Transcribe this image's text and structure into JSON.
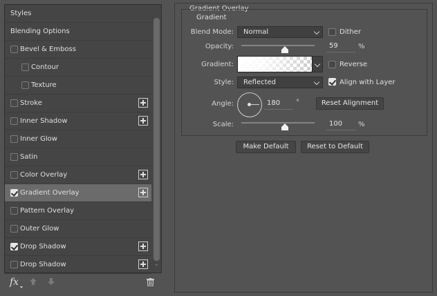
{
  "styles_list": {
    "header": "Styles",
    "blending_options": "Blending Options",
    "items": [
      {
        "label": "Bevel & Emboss",
        "checked": false,
        "add": false,
        "indent": false,
        "selected": false
      },
      {
        "label": "Contour",
        "checked": false,
        "add": false,
        "indent": true,
        "selected": false
      },
      {
        "label": "Texture",
        "checked": false,
        "add": false,
        "indent": true,
        "selected": false
      },
      {
        "label": "Stroke",
        "checked": false,
        "add": true,
        "indent": false,
        "selected": false
      },
      {
        "label": "Inner Shadow",
        "checked": false,
        "add": true,
        "indent": false,
        "selected": false
      },
      {
        "label": "Inner Glow",
        "checked": false,
        "add": false,
        "indent": false,
        "selected": false
      },
      {
        "label": "Satin",
        "checked": false,
        "add": false,
        "indent": false,
        "selected": false
      },
      {
        "label": "Color Overlay",
        "checked": false,
        "add": true,
        "indent": false,
        "selected": false
      },
      {
        "label": "Gradient Overlay",
        "checked": true,
        "add": true,
        "indent": false,
        "selected": true
      },
      {
        "label": "Pattern Overlay",
        "checked": false,
        "add": false,
        "indent": false,
        "selected": false
      },
      {
        "label": "Outer Glow",
        "checked": false,
        "add": false,
        "indent": false,
        "selected": false
      },
      {
        "label": "Drop Shadow",
        "checked": true,
        "add": true,
        "indent": false,
        "selected": false
      },
      {
        "label": "Drop Shadow",
        "checked": false,
        "add": true,
        "indent": false,
        "selected": false
      }
    ]
  },
  "bottom_bar": {
    "fx_label": "fx",
    "icons": [
      "fx-icon",
      "move-up-icon",
      "move-down-icon",
      "trash-icon"
    ]
  },
  "panel": {
    "title": "Gradient Overlay",
    "section": "Gradient",
    "blend_mode": {
      "label": "Blend Mode:",
      "value": "Normal"
    },
    "dither": {
      "label": "Dither",
      "checked": false
    },
    "opacity": {
      "label": "Opacity:",
      "value": "59",
      "unit": "%",
      "level": 0.59
    },
    "gradient": {
      "label": "Gradient:"
    },
    "reverse": {
      "label": "Reverse",
      "checked": false
    },
    "style": {
      "label": "Style:",
      "value": "Reflected"
    },
    "align_with_layer": {
      "label": "Align with Layer",
      "checked": true
    },
    "angle": {
      "label": "Angle:",
      "value": "180",
      "unit": "°"
    },
    "reset_alignment": "Reset Alignment",
    "scale": {
      "label": "Scale:",
      "value": "100",
      "unit": "%",
      "level": 0.59
    },
    "make_default": "Make Default",
    "reset_to_default": "Reset to Default"
  },
  "colors": {
    "background": "#535353",
    "list_background": "#454545",
    "selected_row": "#6b6b6b",
    "text": "#e0e0e0"
  }
}
